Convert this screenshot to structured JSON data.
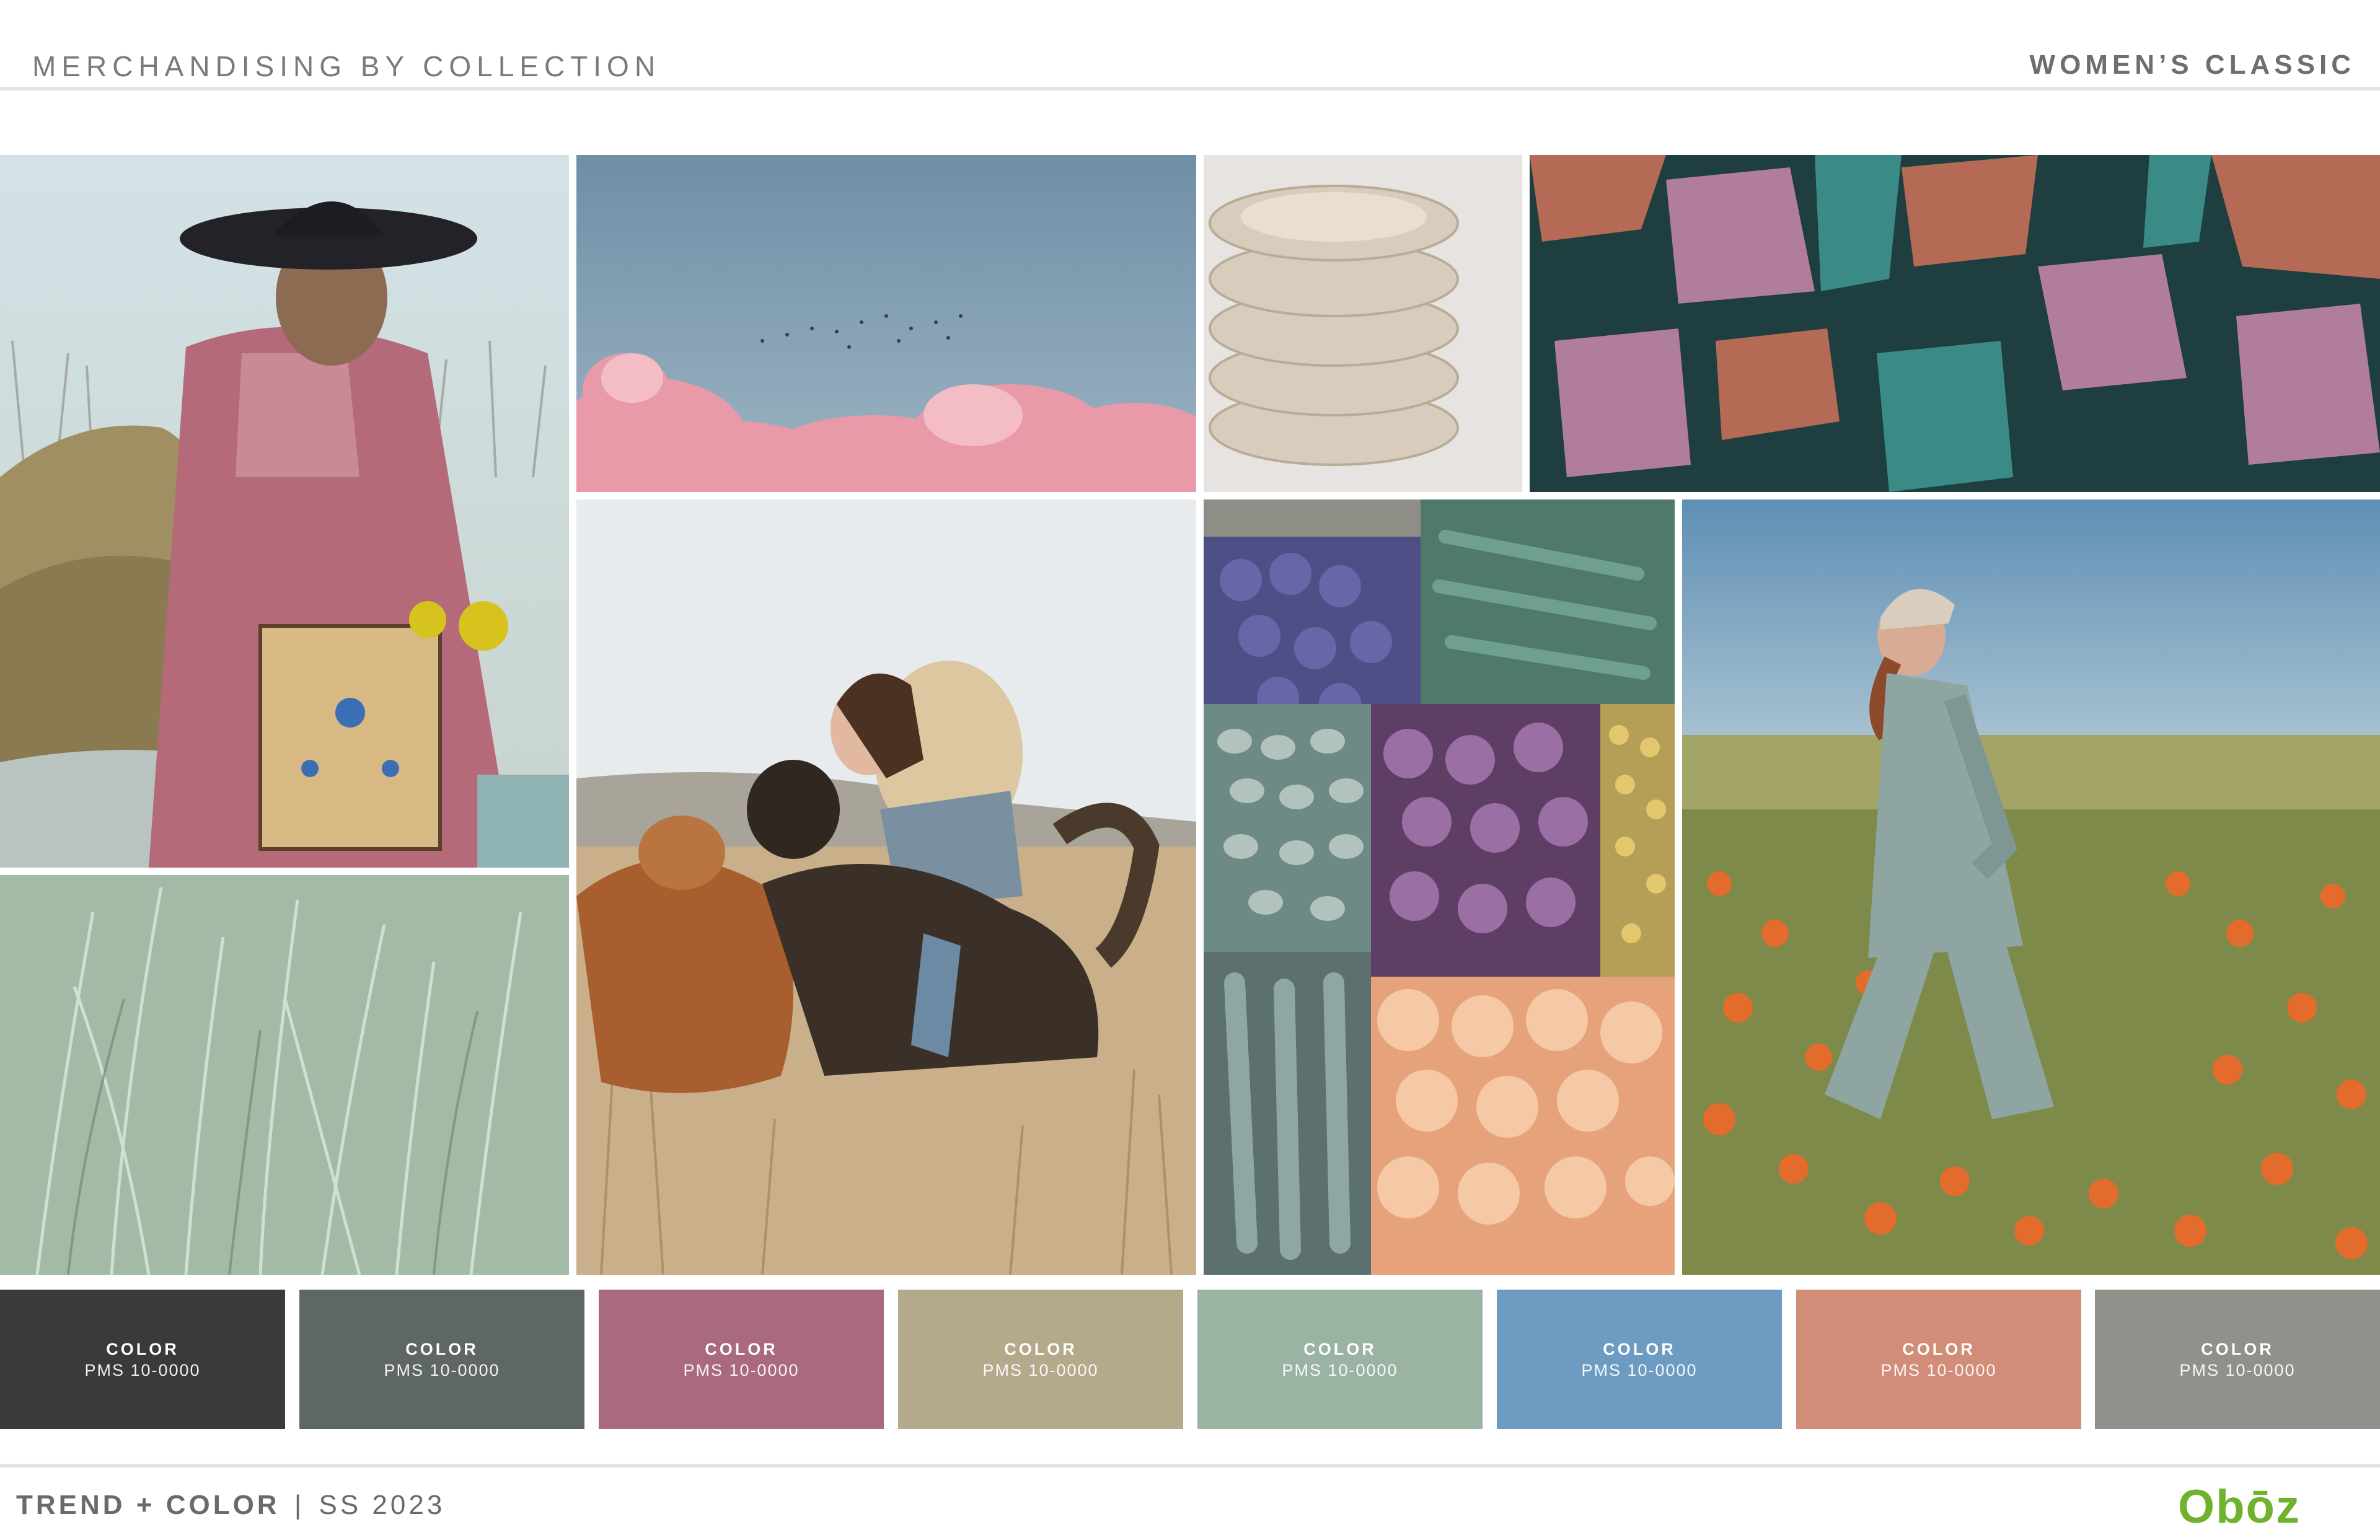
{
  "header": {
    "left_title": "MERCHANDISING BY COLLECTION",
    "right_title": "WOMEN’S CLASSIC"
  },
  "images": [
    {
      "icon": "woman-in-pink-jacket-photo"
    },
    {
      "icon": "pink-clouds-birds-photo"
    },
    {
      "icon": "stacked-plates-photo"
    },
    {
      "icon": "teal-pink-rock-photo"
    },
    {
      "icon": "grass-dew-photo"
    },
    {
      "icon": "girl-with-dogs-photo"
    },
    {
      "icon": "colored-food-blocks-photo"
    },
    {
      "icon": "woman-in-poppy-field-photo"
    }
  ],
  "swatches": [
    {
      "name": "COLOR",
      "code": "PMS 10-0000",
      "color": "#3a3a38"
    },
    {
      "name": "COLOR",
      "code": "PMS 10-0000",
      "color": "#5f6766"
    },
    {
      "name": "COLOR",
      "code": "PMS 10-0000",
      "color": "#a96a7e"
    },
    {
      "name": "COLOR",
      "code": "PMS 10-0000",
      "color": "#b5a98c"
    },
    {
      "name": "COLOR",
      "code": "PMS 10-0000",
      "color": "#9ab3a3"
    },
    {
      "name": "COLOR",
      "code": "PMS 10-0000",
      "color": "#6e9bc2"
    },
    {
      "name": "COLOR",
      "code": "PMS 10-0000",
      "color": "#d18d77"
    },
    {
      "name": "COLOR",
      "code": "PMS 10-0000",
      "color": "#91918b"
    }
  ],
  "footer": {
    "trend": "TREND + COLOR",
    "divider": "|",
    "season": "SS 2023",
    "logo": "Obōz"
  }
}
